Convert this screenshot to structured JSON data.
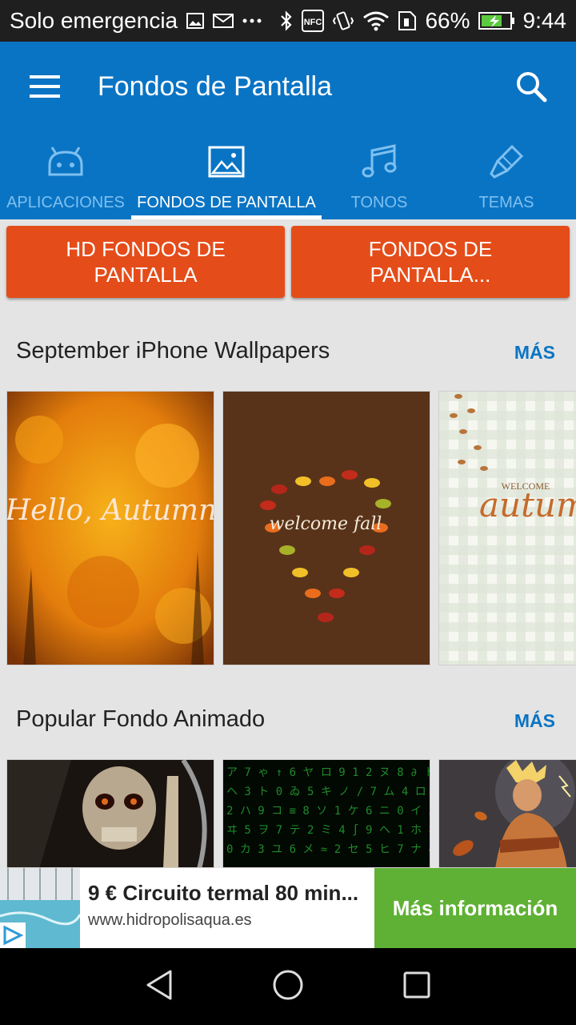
{
  "status_bar": {
    "carrier": "Solo emergencia",
    "battery": "66%",
    "time": "9:44",
    "nfc": "NFC",
    "icons": [
      "image-icon",
      "mail-icon",
      "more-dots-icon",
      "bluetooth-icon",
      "nfc-icon",
      "vibrate-icon",
      "wifi-icon",
      "sim-icon",
      "battery-icon"
    ]
  },
  "app_bar": {
    "title": "Fondos de Pantalla",
    "menu_icon": "hamburger-menu-icon",
    "search_icon": "search-icon",
    "color": "#0a74c4"
  },
  "tabs": [
    {
      "label": "APLICACIONES",
      "icon": "android-icon",
      "active": false
    },
    {
      "label": "FONDOS DE PANTALLA",
      "icon": "image-frame-icon",
      "active": true
    },
    {
      "label": "TONOS",
      "icon": "music-note-icon",
      "active": false
    },
    {
      "label": "TEMAS",
      "icon": "paint-brush-icon",
      "active": false
    }
  ],
  "category_buttons": [
    {
      "label": "HD FONDOS DE PANTALLA"
    },
    {
      "label": "FONDOS DE PANTALLA..."
    }
  ],
  "sections": [
    {
      "title": "September iPhone Wallpapers",
      "more": "MÁS",
      "items": [
        {
          "caption": "Hello, Autumn"
        },
        {
          "caption": "welcome fall"
        },
        {
          "caption_small": "WELCOME",
          "caption": "autumn"
        }
      ]
    },
    {
      "title": "Popular Fondo Animado",
      "more": "MÁS",
      "items": [
        {
          "subject": "skull"
        },
        {
          "subject": "matrix"
        },
        {
          "subject": "warrior"
        }
      ]
    }
  ],
  "ad": {
    "title": "9 € Circuito termal 80 min...",
    "url": "www.hidropolisaqua.es",
    "cta": "Más información",
    "cta_color": "#5fb135"
  },
  "nav_bar": {
    "icons": [
      "back-icon",
      "home-icon",
      "recents-icon"
    ]
  },
  "accent_color": "#e44d1a"
}
